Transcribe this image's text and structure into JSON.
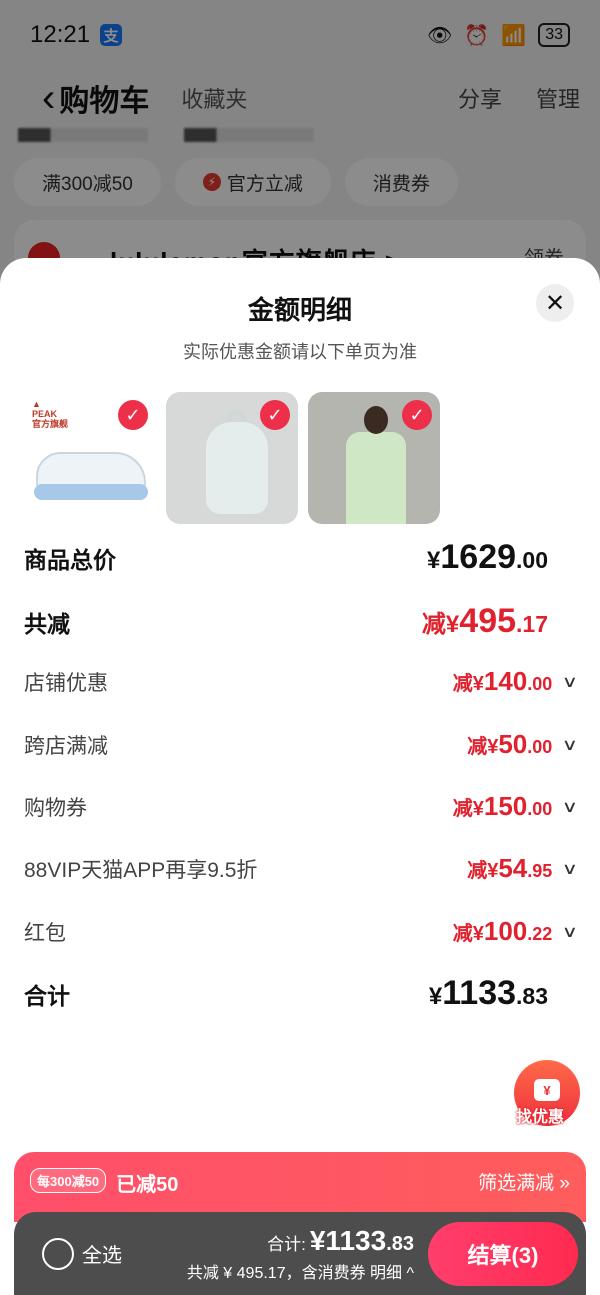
{
  "status_bar": {
    "time": "12:21",
    "alipay_badge": "支",
    "battery": "33"
  },
  "nav": {
    "title": "购物车",
    "tab_favorites": "收藏夹",
    "share": "分享",
    "manage": "管理"
  },
  "chips": [
    "满300减50",
    "官方立减",
    "消费券"
  ],
  "store": {
    "name": "lululemon官方旗舰店 >",
    "coupon": "领券"
  },
  "sheet": {
    "title": "金额明细",
    "subtitle": "实际优惠金额请以下单页为准",
    "close_icon": "close-icon",
    "products": [
      {
        "name": "sneaker",
        "brand_text": "PEAK 官方旗舰",
        "selected": true
      },
      {
        "name": "sling bag",
        "selected": true
      },
      {
        "name": "green shirt",
        "selected": true
      }
    ],
    "rows": {
      "subtotal": {
        "label": "商品总价",
        "symbol": "¥",
        "int": "1629",
        "dec": ".00"
      },
      "total_discount": {
        "label": "共减",
        "prefix": "减¥",
        "int": "495",
        "dec": ".17"
      },
      "store_discount": {
        "label": "店铺优惠",
        "prefix": "减¥",
        "int": "140",
        "dec": ".00"
      },
      "cross_store": {
        "label": "跨店满减",
        "prefix": "减¥",
        "int": "50",
        "dec": ".00"
      },
      "shopping_coupon": {
        "label": "购物券",
        "prefix": "减¥",
        "int": "150",
        "dec": ".00"
      },
      "vip": {
        "label": "88VIP天猫APP再享9.5折",
        "prefix": "减¥",
        "int": "54",
        "dec": ".95"
      },
      "red_packet": {
        "label": "红包",
        "prefix": "减¥",
        "int": "100",
        "dec": ".22"
      },
      "total": {
        "label": "合计",
        "symbol": "¥",
        "int": "1133",
        "dec": ".83"
      }
    }
  },
  "find_deal": {
    "icon": "¥",
    "label": "找优惠"
  },
  "promo_bar": {
    "badge": "每300减50",
    "done": "已减50",
    "link": "筛选满减 »"
  },
  "checkout": {
    "select_all": "全选",
    "total_label": "合计:",
    "total_int": "¥1133",
    "total_dec": ".83",
    "sub_text": "共减 ¥ 495.17，含消费券  明细 ^",
    "button": "结算(3)"
  },
  "colors": {
    "accent_red": "#e0212e",
    "checkout_pink": "#ff2a50",
    "bottom_bar": "#4d4d4d"
  }
}
